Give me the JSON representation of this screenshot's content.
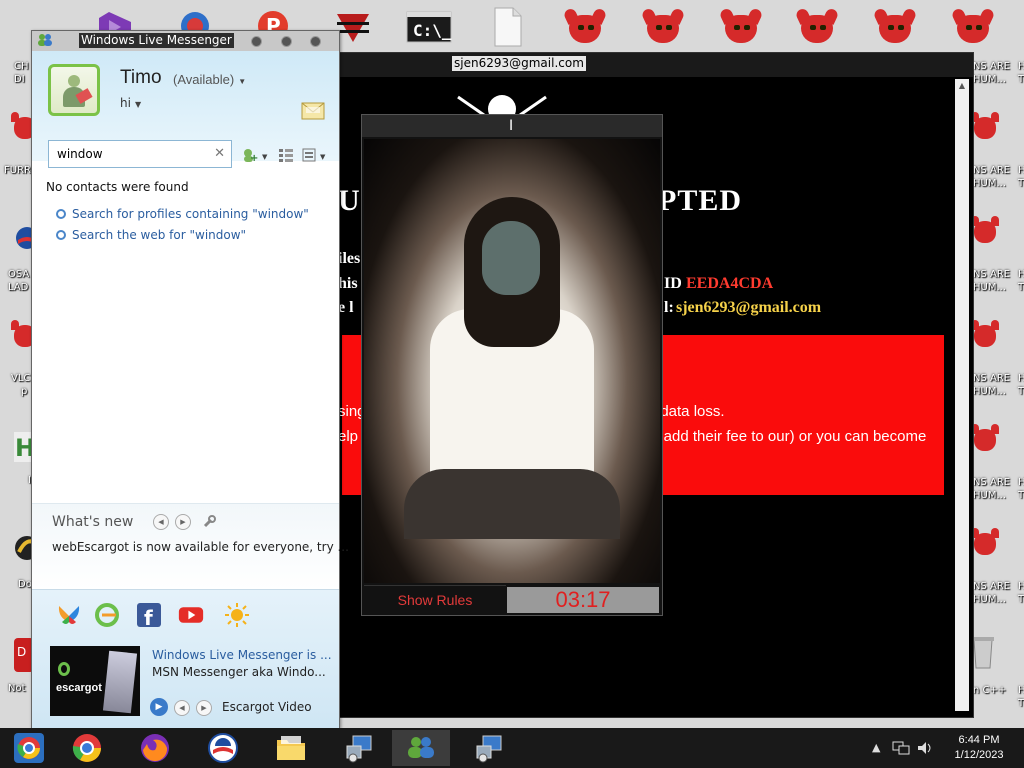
{
  "colors": {
    "accent_red": "#fa0c0c",
    "email_yellow": "#f6d24a",
    "id_red": "#ff3b2f",
    "link_blue": "#2a5d9f",
    "status_green": "#7bc247"
  },
  "desktop": {
    "top_icons": [
      "visual-studio-icon",
      "blue-red-icon",
      "red-logo-icon",
      "red-v-icon",
      "command-prompt-icon",
      "blank-file-icon",
      "devil-icon",
      "devil-icon",
      "devil-icon",
      "devil-icon",
      "devil-icon",
      "devil-icon",
      "devil-icon",
      "devil-icon",
      "devil-icon"
    ],
    "left_labels": [
      {
        "l1": "CH",
        "l2": "DI"
      },
      {
        "l1": "FURR",
        "l2": ""
      },
      {
        "l1": "OSA",
        "l2": "LAD"
      },
      {
        "l1": "VLC",
        "l2": "p"
      },
      {
        "l1": "",
        "l2": "I"
      },
      {
        "l1": "Do",
        "l2": ""
      },
      {
        "l1": "Not",
        "l2": ""
      }
    ],
    "right_labels": [
      {
        "l1": "NS ARE",
        "l2": "HUM...",
        "x1": "H",
        "x2": "T"
      },
      {
        "l1": "NS ARE",
        "l2": "HUM...",
        "x1": "H",
        "x2": "T"
      },
      {
        "l1": "NS ARE",
        "l2": "HUM...",
        "x1": "H",
        "x2": "T"
      },
      {
        "l1": "NS ARE",
        "l2": "HUM...",
        "x1": "H",
        "x2": "T"
      },
      {
        "l1": "NS ARE",
        "l2": "HUM...",
        "x1": "H",
        "x2": "T"
      },
      {
        "l1": "NS ARE",
        "l2": "HUM...",
        "x1": "H",
        "x2": "T"
      },
      {
        "l1": "n C++",
        "l2": "",
        "x1": "H",
        "x2": "T"
      }
    ]
  },
  "ransom_window": {
    "title": "sjen6293@gmail.com",
    "heading_left": "UR",
    "heading_right": "PTED",
    "line1": "iles",
    "line2_left": "his",
    "line2_id_label": "ID",
    "line2_id": "EEDA4CDA",
    "line3_left": "e l",
    "line3_right_label": "l:",
    "line3_email": "sjen6293@gmail.com",
    "red_line1_left": "sing",
    "red_line1_right": "t data loss.",
    "red_line2_left": "elp c",
    "red_line2_right": "y add their fee to our) or you can become"
  },
  "video_window": {
    "title_glyph": "I",
    "show_rules": "Show Rules",
    "timer": "03:17"
  },
  "messenger": {
    "title": "Windows Live Messenger",
    "user_name": "Timo",
    "status": "(Available)",
    "personal_message": "hi",
    "search_value": "window",
    "no_contacts": "No contacts were found",
    "search_profiles": "Search for profiles containing \"window\"",
    "search_web": "Search the web for \"window\"",
    "whats_new_title": "What's new",
    "whats_new_item": "webEscargot is now available for everyone, try ...",
    "video_title": "Windows Live Messenger is ...",
    "video_desc": "MSN Messenger aka Windo...",
    "video_label": "Escargot Video",
    "thumb_label": "escargot"
  },
  "taskbar": {
    "time": "6:44 PM",
    "date": "1/12/2023",
    "apps": [
      "chrome-old-icon",
      "chrome-icon",
      "firefox-icon",
      "obama-logo-icon",
      "file-explorer-icon",
      "network-app-icon",
      "messenger-icon",
      "network-app-icon"
    ]
  }
}
